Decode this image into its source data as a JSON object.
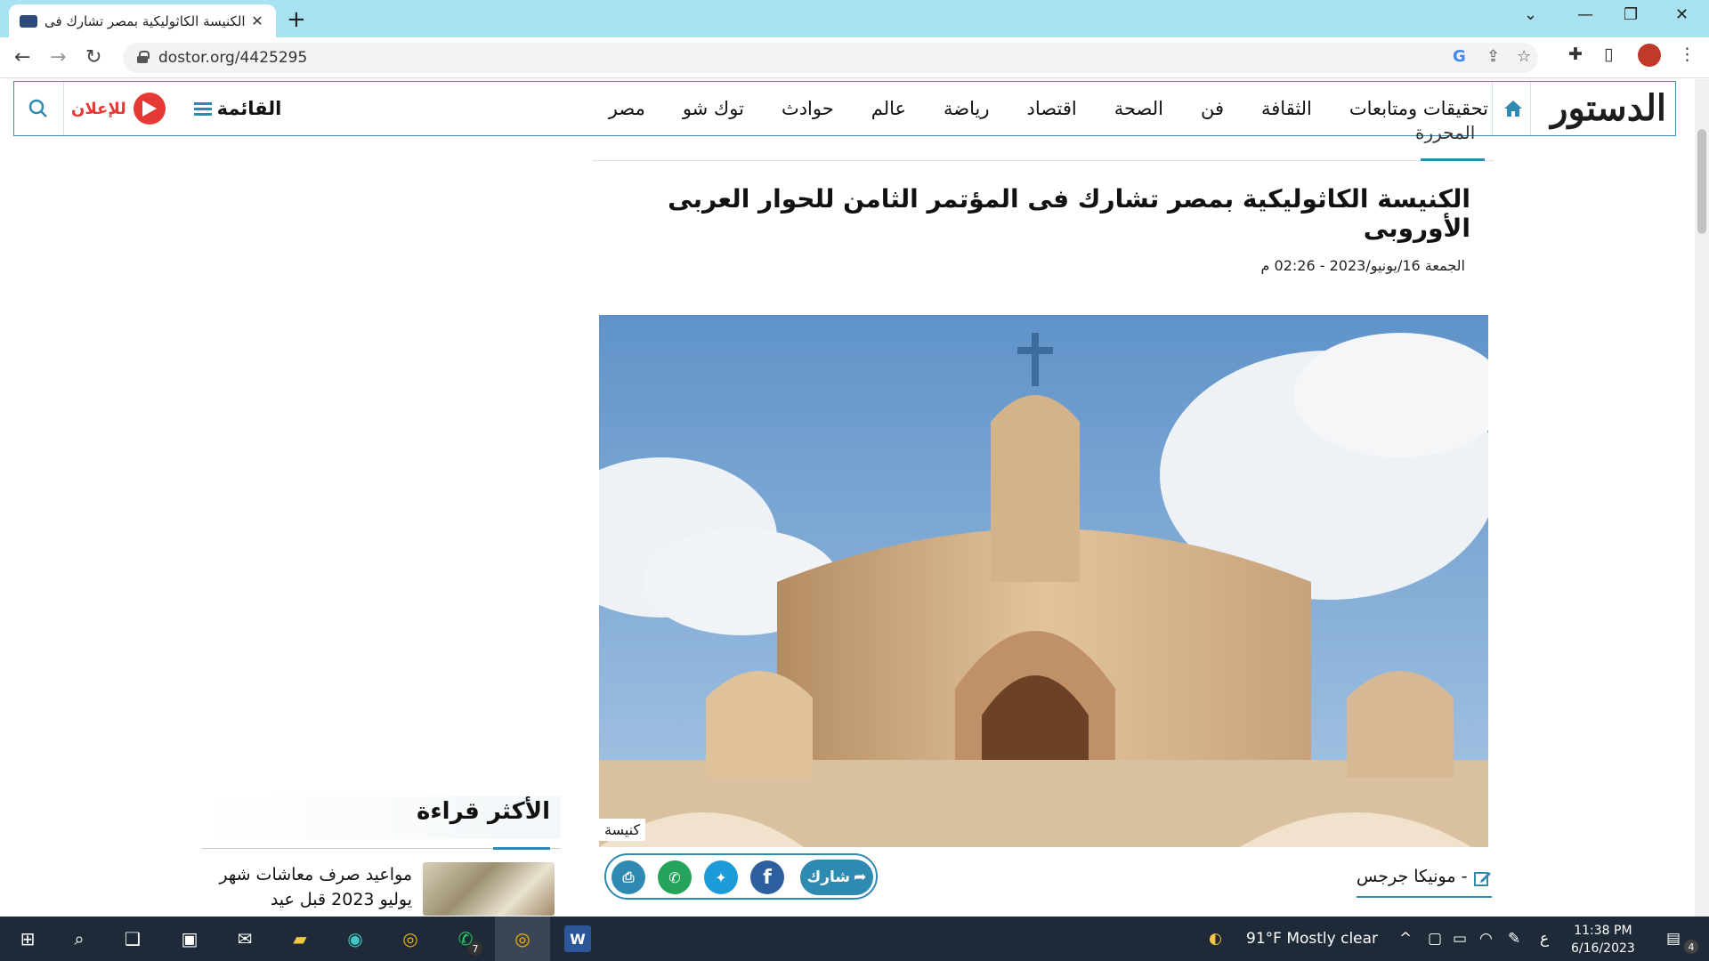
{
  "browser": {
    "tab_title": "الكنيسة الكاثوليكية بمصر تشارك فى",
    "url": "dostor.org/4425295"
  },
  "site": {
    "logo": "الدستور",
    "nav": [
      "مصر",
      "توك شو",
      "حوادث",
      "عالم",
      "رياضة",
      "اقتصاد",
      "الصحة",
      "فن",
      "الثقافة",
      "تحقيقات ومتابعات"
    ],
    "menu_label": "القائمة",
    "ad_label": "للإعلان"
  },
  "article": {
    "section": "المحررة",
    "headline": "الكنيسة الكاثوليكية بمصر تشارك فى المؤتمر الثامن للحوار العربى الأوروبى",
    "date": "الجمعة 16/يونيو/2023 - 02:26 م",
    "image_caption": "كنيسة",
    "author": "- مونيكا جرجس",
    "share_label": "شارك"
  },
  "sidebar": {
    "title": "الأكثر قراءة",
    "item_text": "مواعيد صرف معاشات شهر يوليو 2023 قبل عيد"
  },
  "taskbar": {
    "weather": "91°F  Mostly clear",
    "ime": "ع",
    "time": "11:38 PM",
    "date": "6/16/2023",
    "whatsapp_badge": "7",
    "notif_badge": "4"
  },
  "colors": {
    "accent": "#2e8ab0",
    "ad_red": "#e53935",
    "tabstrip": "#a8e1f0",
    "taskbar": "#1f2a38"
  }
}
